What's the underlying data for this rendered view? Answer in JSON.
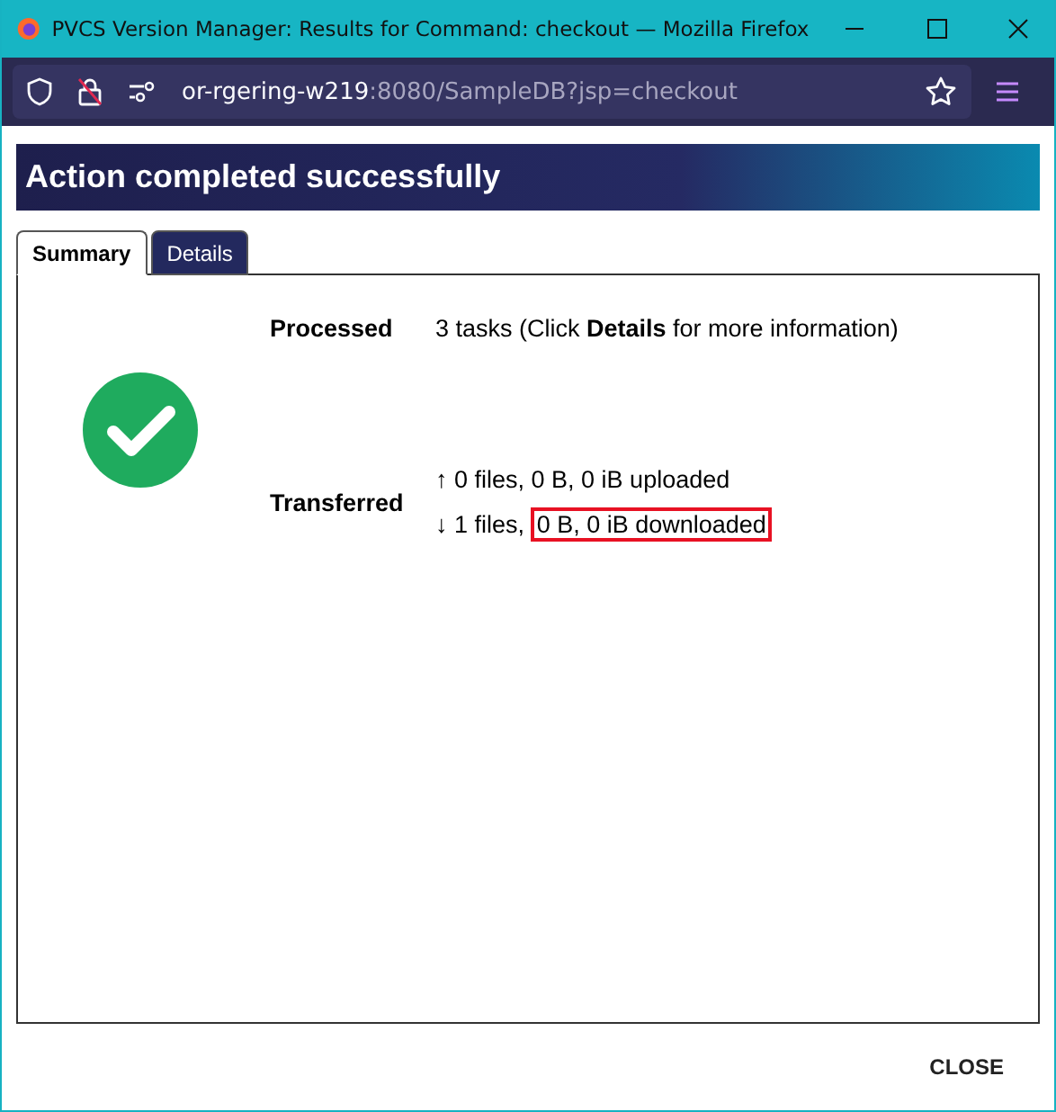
{
  "window": {
    "title": "PVCS Version Manager: Results for Command: checkout — Mozilla Firefox"
  },
  "address_bar": {
    "host": "or-rgering-w219",
    "path": ":8080/SampleDB?jsp=checkout"
  },
  "banner": {
    "title": "Action completed successfully"
  },
  "tabs": [
    {
      "label": "Summary",
      "selected": true
    },
    {
      "label": "Details",
      "selected": false
    }
  ],
  "summary": {
    "success": true,
    "processed": {
      "label": "Processed",
      "text": "3 tasks (Click **Details** for more information)"
    },
    "transferred": {
      "label": "Transferred",
      "lines": [
        {
          "arrow": "↑",
          "text": "0 files, 0 B, 0 iB uploaded"
        },
        {
          "arrow": "↓",
          "text": "1 files,",
          "highlighted_text": "0 B, 0 iB downloaded"
        }
      ]
    }
  },
  "buttons": [
    {
      "label": "CLOSE"
    }
  ]
}
